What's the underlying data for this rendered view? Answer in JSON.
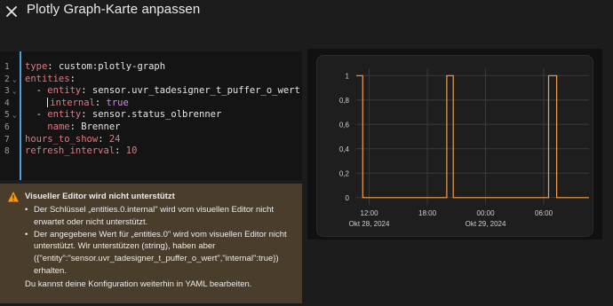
{
  "dialog": {
    "title": "Plotly Graph-Karte anpassen"
  },
  "editor": {
    "line_numbers": [
      "1",
      "2",
      "3",
      "4",
      "5",
      "6",
      "7",
      "8"
    ],
    "lines": {
      "l1": {
        "key": "type",
        "value": " custom:plotly-graph"
      },
      "l2": {
        "key": "entities"
      },
      "l3": {
        "dash": "  - ",
        "key": "entity",
        "value": " sensor.uvr_tadesigner_t_puffer_o_wert"
      },
      "l4": {
        "key": "internal",
        "value": " true"
      },
      "l5": {
        "dash": "  - ",
        "key": "entity",
        "value": " sensor.status_olbrenner"
      },
      "l6": {
        "key": "name",
        "value": " Brenner"
      },
      "l7": {
        "key": "hours_to_show",
        "value": " 24"
      },
      "l8": {
        "key": "refresh_interval",
        "value": " 10"
      }
    }
  },
  "warning": {
    "title": "Visueller Editor wird nicht unterstützt",
    "item1": "Der Schlüssel „entities.0.internal\" wird vom visuellen Editor nicht erwartet oder nicht unterstützt.",
    "item2": "Der angegebene Wert für „entities.0\" wird vom visuellen Editor nicht unterstützt. Wir unterstützen (string), haben aber ({\"entity\":\"sensor.uvr_tadesigner_t_puffer_o_wert\",\"internal\":true}) erhalten.",
    "footer": "Du kannst deine Konfiguration weiterhin in YAML bearbeiten.",
    "color": "#4a3d2b",
    "icon_color": "#ff9800"
  },
  "chart_data": {
    "type": "line",
    "series": [
      {
        "color": "#f0a050",
        "x": [
          "2024-10-28 10:40",
          "2024-10-28 11:20",
          "2024-10-28 11:20",
          "2024-10-28 20:00",
          "2024-10-28 20:00",
          "2024-10-28 20:40",
          "2024-10-28 20:40",
          "2024-10-29 06:30",
          "2024-10-29 06:30",
          "2024-10-29 07:20",
          "2024-10-29 07:20",
          "2024-10-29 10:40"
        ],
        "y": [
          1,
          1,
          0,
          0,
          1,
          1,
          0,
          0,
          1,
          1,
          0,
          0
        ]
      }
    ],
    "x_ticks": [
      {
        "t": "2024-10-28 12:00",
        "label": "12:00"
      },
      {
        "t": "2024-10-28 18:00",
        "label": "18:00"
      },
      {
        "t": "2024-10-29 00:00",
        "label": "00:00"
      },
      {
        "t": "2024-10-29 06:00",
        "label": "06:00"
      }
    ],
    "x_date_labels": [
      {
        "t": "2024-10-28 12:00",
        "label": "Okt 28, 2024"
      },
      {
        "t": "2024-10-29 00:00",
        "label": "Okt 29, 2024"
      }
    ],
    "y_ticks": [
      "0",
      "0,2",
      "0,4",
      "0,6",
      "0,8",
      "1"
    ],
    "y_values": [
      0,
      0.2,
      0.4,
      0.6,
      0.8,
      1
    ],
    "xlim": [
      "2024-10-28 10:40",
      "2024-10-29 10:40"
    ],
    "ylim": [
      -0.06,
      1.06
    ],
    "grid": true
  }
}
